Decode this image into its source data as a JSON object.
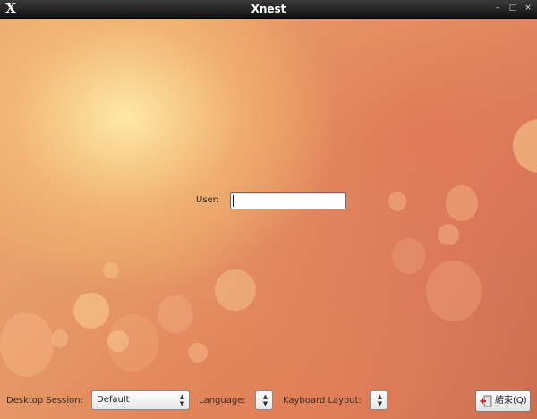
{
  "window": {
    "title": "Xnest",
    "controls": {
      "minimize": "–",
      "maximize": "□",
      "close": "×"
    }
  },
  "login": {
    "user_label": "User:",
    "user_value": ""
  },
  "bottom_bar": {
    "desktop_session_label": "Desktop Session:",
    "desktop_session_value": "Default",
    "language_label": "Language:",
    "language_value": "",
    "keyboard_layout_label": "Kayboard Layout:",
    "keyboard_layout_value": "",
    "quit_label": "結束(Q)"
  },
  "icons": {
    "app": "x-logo-icon",
    "combo_arrows": "updown-arrows-icon",
    "quit": "exit-door-icon"
  },
  "colors": {
    "titlebar": "#1a1a1a",
    "background_warm": "#e59a68"
  }
}
